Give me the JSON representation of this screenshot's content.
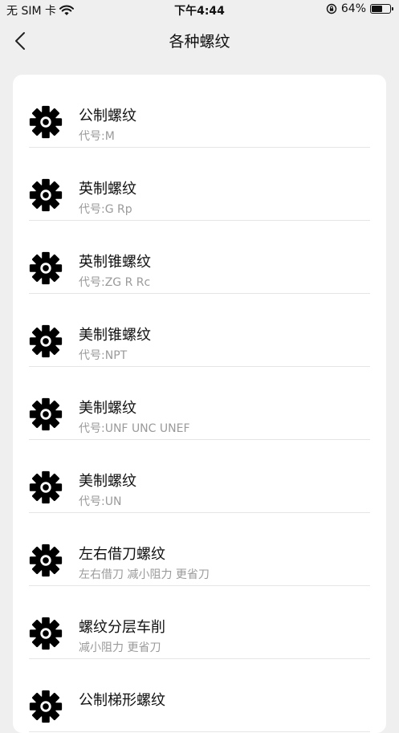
{
  "status_bar": {
    "carrier": "无 SIM 卡",
    "time": "下午4:44",
    "battery_percent": "64%",
    "battery_level": 0.64,
    "icons": [
      "wifi-icon",
      "orientation-lock-icon",
      "battery-icon"
    ]
  },
  "nav": {
    "title": "各种螺纹",
    "back_icon": "chevron-left-icon"
  },
  "list": {
    "item_icon": "gear-icon",
    "items": [
      {
        "title": "公制螺纹",
        "subtitle": "代号:M"
      },
      {
        "title": "英制螺纹",
        "subtitle": "代号:G Rp"
      },
      {
        "title": "英制锥螺纹",
        "subtitle": "代号:ZG R Rc"
      },
      {
        "title": "美制锥螺纹",
        "subtitle": "代号:NPT"
      },
      {
        "title": "美制螺纹",
        "subtitle": "代号:UNF UNC UNEF"
      },
      {
        "title": "美制螺纹",
        "subtitle": "代号:UN"
      },
      {
        "title": "左右借刀螺纹",
        "subtitle": "左右借刀 减小阻力 更省刀"
      },
      {
        "title": "螺纹分层车削",
        "subtitle": "减小阻力 更省刀"
      },
      {
        "title": "公制梯形螺纹",
        "subtitle": ""
      }
    ]
  }
}
